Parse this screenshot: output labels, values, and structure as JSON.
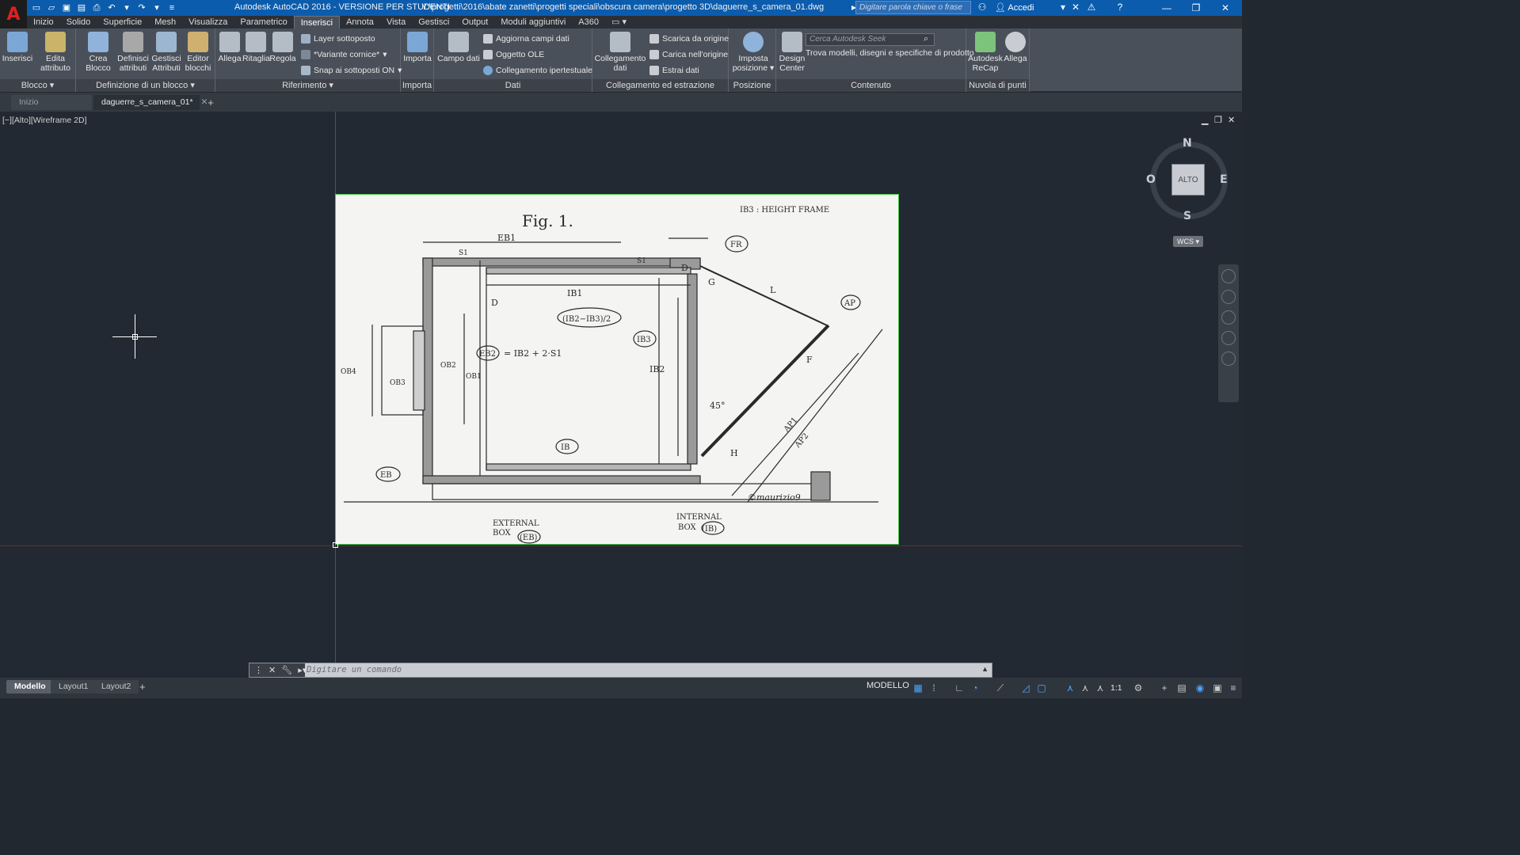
{
  "title_bar": {
    "app_title": "Autodesk AutoCAD 2016 - VERSIONE PER STUDENTI",
    "file_path": "Y:\\progetti\\2016\\abate zanetti\\progetti speciali\\obscura camera\\progetto 3D\\daguerre_s_camera_01.dwg",
    "search_placeholder": "Digitare parola chiave o frase",
    "sign_in": "Accedi"
  },
  "menu_tabs": [
    "Inizio",
    "Solido",
    "Superficie",
    "Mesh",
    "Visualizza",
    "Parametrico",
    "Inserisci",
    "Annota",
    "Vista",
    "Gestisci",
    "Output",
    "Moduli aggiuntivi",
    "A360"
  ],
  "active_menu_tab": "Inserisci",
  "ribbon": {
    "blocco": {
      "label": "Blocco",
      "inserisci": "Inserisci",
      "edita1": "Edita",
      "edita2": "attributo"
    },
    "definizione": {
      "label": "Definizione di un blocco",
      "crea1": "Crea",
      "crea2": "Blocco",
      "def1": "Definisci",
      "def2": "attributi",
      "ges1": "Gestisci",
      "ges2": "Attributi",
      "ed1": "Editor",
      "ed2": "blocchi"
    },
    "riferimento": {
      "label": "Riferimento",
      "allega": "Allega",
      "ritaglia": "Ritaglia",
      "regola": "Regola",
      "layer": "Layer sottoposto",
      "variante": "*Variante cornice*",
      "snap": "Snap ai sottoposti ON"
    },
    "importa": {
      "label": "Importa",
      "importa": "Importa"
    },
    "dati": {
      "label": "Dati",
      "campo": "Campo dati",
      "aggiorna": "Aggiorna campi dati",
      "ole": "Oggetto OLE",
      "ipertesto": "Collegamento ipertestuale"
    },
    "collegamento": {
      "label": "Collegamento ed estrazione",
      "coll1": "Collegamento",
      "coll2": "dati",
      "scarica": "Scarica da origine",
      "carica": "Carica nell'origine",
      "estrai": "Estrai  dati"
    },
    "posizione": {
      "label": "Posizione",
      "imp1": "Imposta",
      "imp2": "posizione"
    },
    "contenuto": {
      "label": "Contenuto",
      "design1": "Design",
      "design2": "Center",
      "seek_placeholder": "Cerca Autodesk Seek",
      "seek_desc": "Trova modelli, disegni e specifiche di prodotto"
    },
    "nuvola": {
      "label": "Nuvola di punti",
      "recap1": "Autodesk",
      "recap2": "ReCap",
      "allega1": "Allega",
      "allega2": "..."
    }
  },
  "file_tabs": {
    "home": "Inizio",
    "active": "daguerre_s_camera_01*"
  },
  "viewport": {
    "label": "[−][Alto][Wireframe 2D]",
    "viewcube": {
      "top": "ALTO",
      "n": "N",
      "s": "S",
      "e": "E",
      "w": "O",
      "wcs": "WCS"
    }
  },
  "drawing_text": {
    "fig": "Fig. 1.",
    "ib3": "IB3 : HEIGHT FRAME",
    "eb1": "EB1",
    "s1a": "S1",
    "s1b": "S1",
    "fr": "FR",
    "d1": "D",
    "g": "G",
    "l": "L",
    "ap": "AP",
    "ib1": "IB1",
    "formula1": "(IB2−IB3)/2",
    "ib3b": "IB3",
    "d2": "D",
    "eb2": "EB2",
    "formula2": "= IB2 + 2·S1",
    "ob2": "OB2",
    "ob1": "OB1",
    "ob3": "OB3",
    "ob4": "OB4",
    "ib2": "IB2",
    "f": "F",
    "angle": "45°",
    "ap1": "AP1",
    "ap2": "AP2",
    "ib": "IB",
    "eb": "EB",
    "h": "H",
    "signature": "©maurizio9",
    "ext1": "EXTERNAL",
    "ext2": "BOX",
    "ext3": "(EB)",
    "int1": "INTERNAL",
    "int2": "BOX",
    "int3": "(IB)"
  },
  "command_line": {
    "placeholder": "Digitare un comando"
  },
  "status_bar": {
    "layout_tabs": [
      "Modello",
      "Layout1",
      "Layout2"
    ],
    "active_layout": "Modello",
    "mode": "MODELLO",
    "scale": "1:1"
  }
}
